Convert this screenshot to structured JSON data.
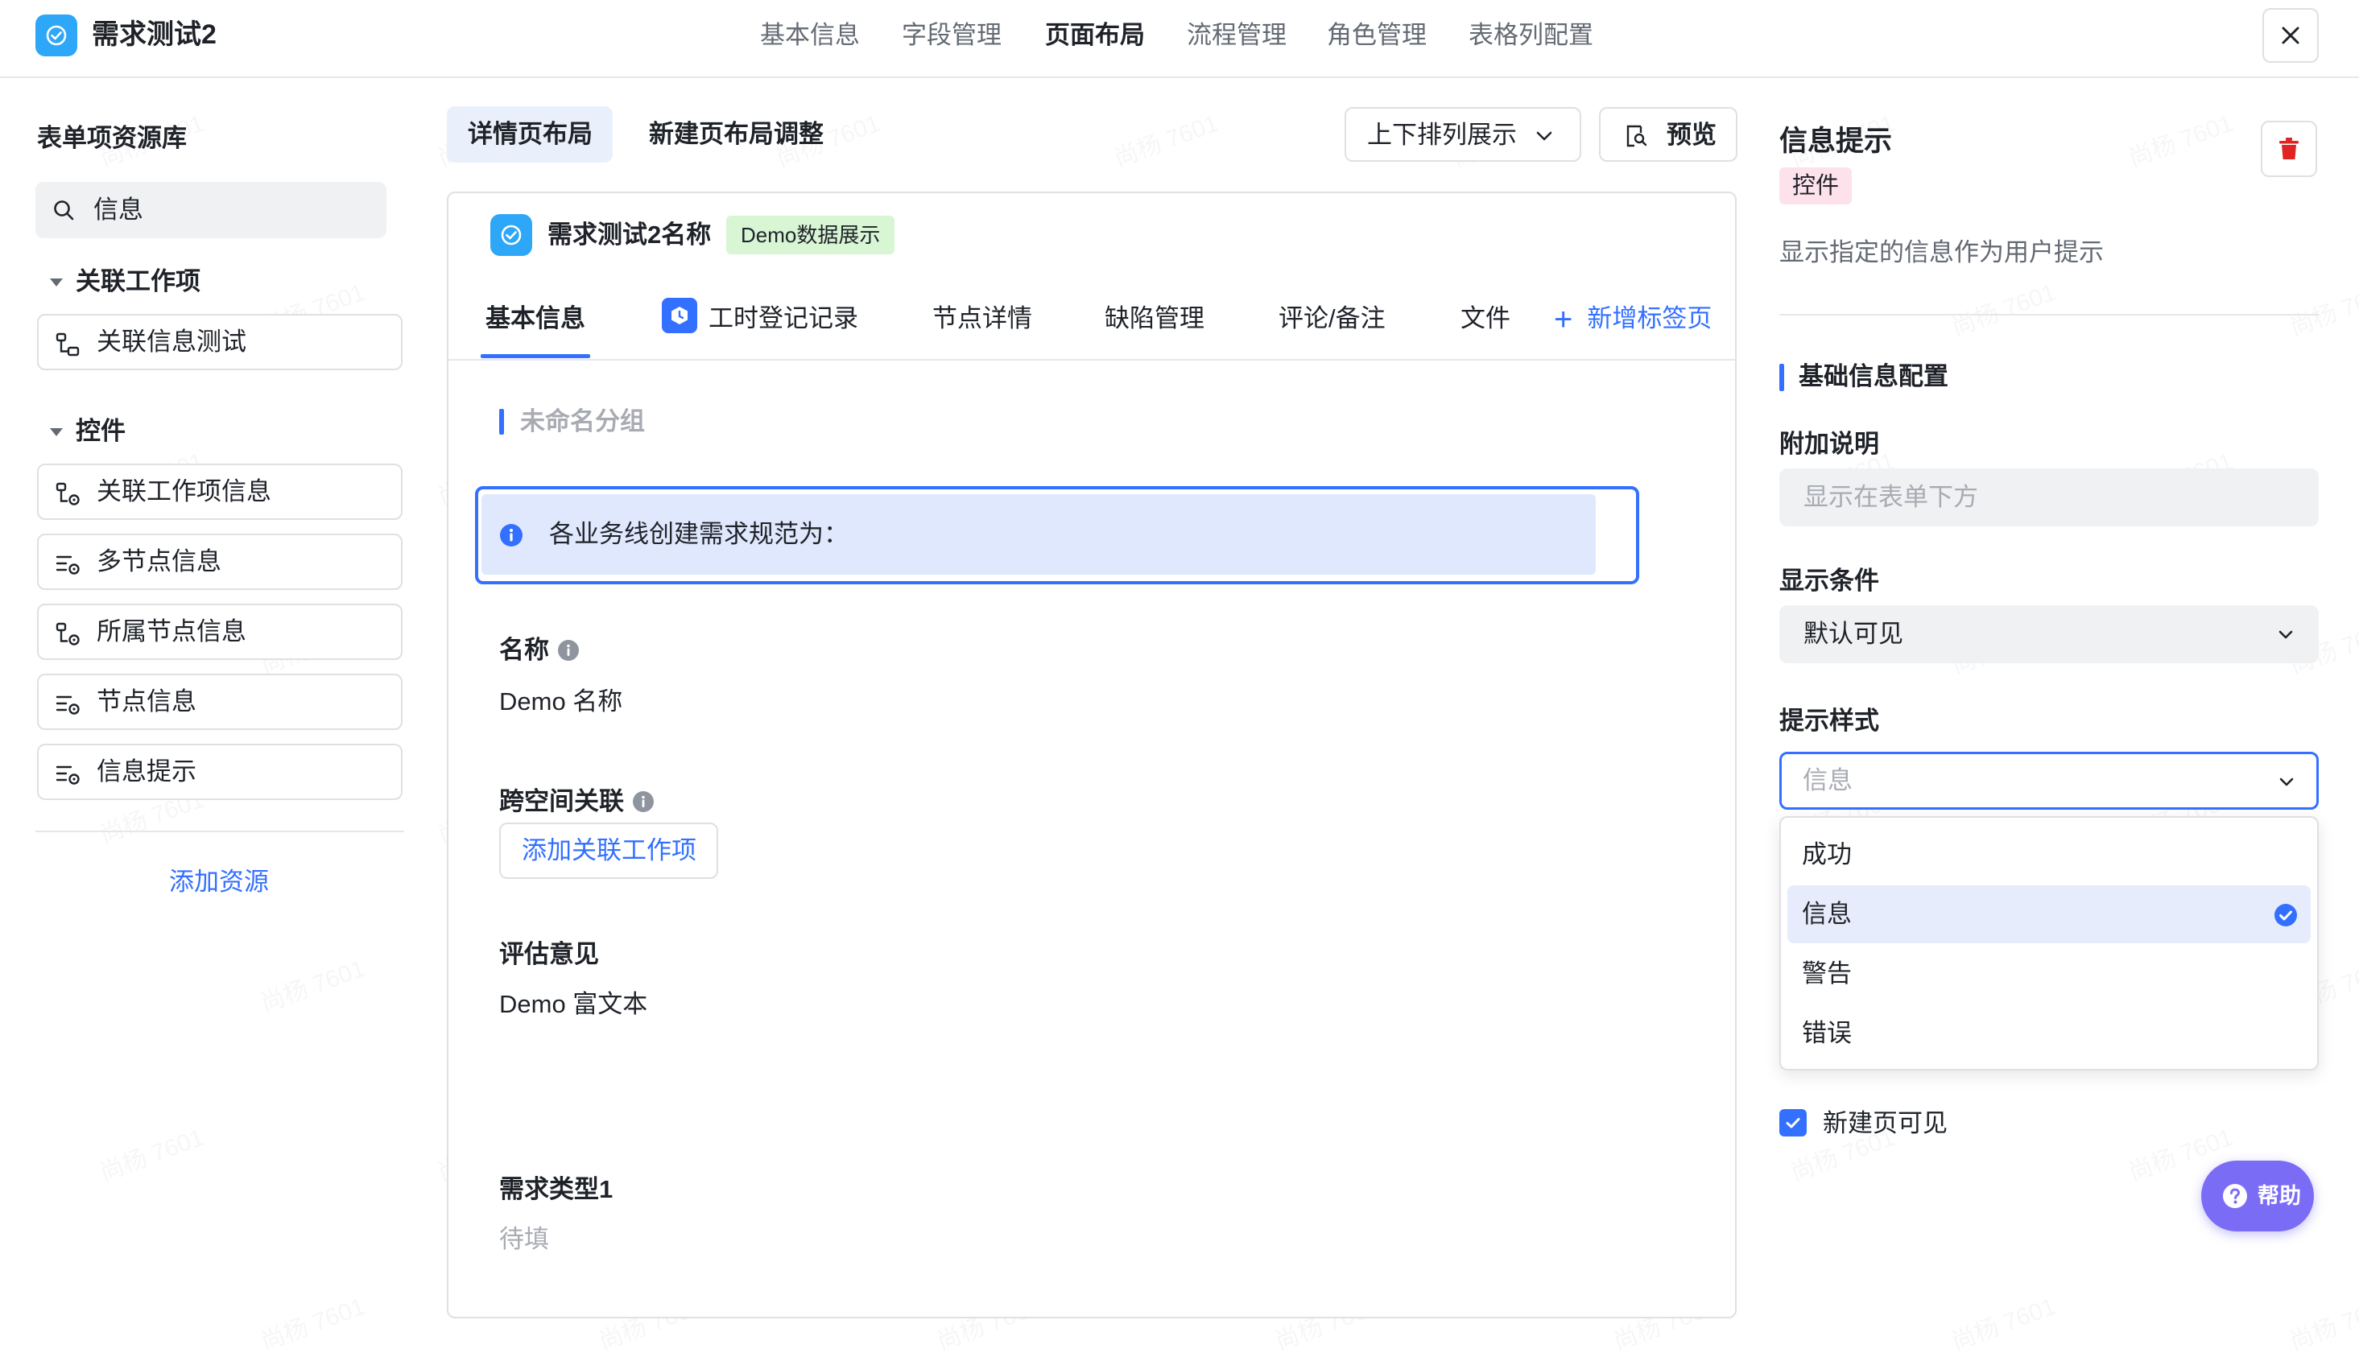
{
  "app": {
    "title": "需求测试2"
  },
  "top_tabs": [
    "基本信息",
    "字段管理",
    "页面布局",
    "流程管理",
    "角色管理",
    "表格列配置"
  ],
  "left_panel": {
    "title": "表单项资源库",
    "search_value": "信息",
    "groups": [
      {
        "name": "关联工作项",
        "items": [
          "关联信息测试"
        ]
      },
      {
        "name": "控件",
        "items": [
          "关联工作项信息",
          "多节点信息",
          "所属节点信息",
          "节点信息",
          "信息提示"
        ]
      }
    ],
    "add_resource": "添加资源"
  },
  "center": {
    "layout_tabs": [
      "详情页布局",
      "新建页布局调整"
    ],
    "sort_select": "上下排列展示",
    "preview": "预览",
    "card": {
      "title": "需求测试2名称",
      "badge": "Demo数据展示",
      "tabs": [
        "基本信息",
        "工时登记记录",
        "节点详情",
        "缺陷管理",
        "评论/备注",
        "文件"
      ],
      "add_tab": "新增标签页",
      "group_label": "未命名分组",
      "tip_text": "各业务线创建需求规范为：",
      "fields": [
        {
          "label": "名称",
          "value": "Demo 名称"
        },
        {
          "label": "跨空间关联",
          "button": "添加关联工作项"
        },
        {
          "label": "评估意见",
          "value": "Demo 富文本"
        },
        {
          "label": "需求类型1",
          "placeholder": "待填"
        }
      ]
    }
  },
  "right_panel": {
    "title": "信息提示",
    "badge": "控件",
    "description": "显示指定的信息作为用户提示",
    "section_title": "基础信息配置",
    "extra_label": "附加说明",
    "extra_placeholder": "显示在表单下方",
    "condition_label": "显示条件",
    "condition_value": "默认可见",
    "style_label": "提示样式",
    "style_value": "信息",
    "style_options": [
      "成功",
      "信息",
      "警告",
      "错误"
    ],
    "selected_option": "信息",
    "new_page_visible": "新建页可见",
    "help": "帮助"
  },
  "watermark": "尚杨 7601",
  "colors": {
    "accent": "#3370ff",
    "logo": "#2ea7f8",
    "delete": "#e02424",
    "help": "#7b6cf6"
  }
}
